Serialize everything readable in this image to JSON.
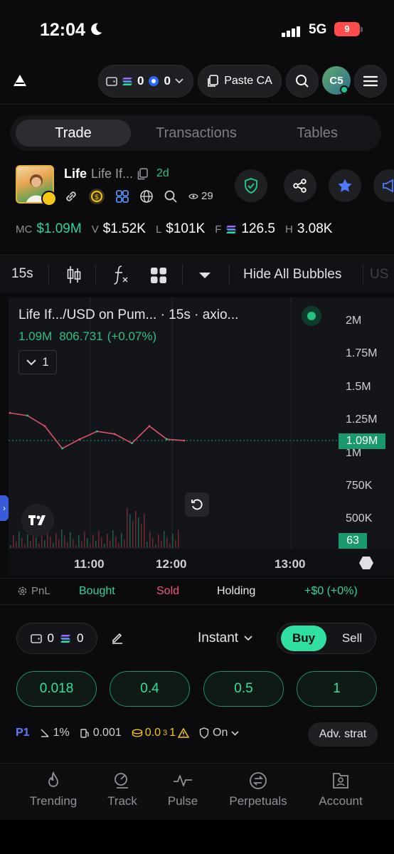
{
  "status": {
    "time": "12:04",
    "network": "5G",
    "battery": "9"
  },
  "topnav": {
    "sol_balance": "0",
    "coin_balance": "0",
    "paste_label": "Paste CA",
    "avatar_initials": "C5"
  },
  "tabs": [
    "Trade",
    "Transactions",
    "Tables"
  ],
  "token": {
    "name": "Life",
    "subtitle": "Life If...",
    "age": "2d",
    "watchers": "29"
  },
  "stats": {
    "mc_label": "MC",
    "mc_value": "$1.09M",
    "v_label": "V",
    "v_value": "$1.52K",
    "l_label": "L",
    "l_value": "$101K",
    "f_label": "F",
    "f_value": "126.5",
    "h_label": "H",
    "h_value": "3.08K"
  },
  "toolbar": {
    "interval": "15s",
    "hide_bubbles": "Hide All Bubbles",
    "currency": "US"
  },
  "chart": {
    "title": "Life If.../USD on Pum...   · 15s · axio...",
    "ohlc_value": "1.09M",
    "ohlc_price": "806.731",
    "ohlc_change": "(+0.07%)",
    "collapse_count": "1",
    "y_labels": [
      "2M",
      "1.75M",
      "1.5M",
      "1.25M",
      "1M",
      "750K",
      "500K"
    ],
    "price_tag": "1.09M",
    "volume_tag": "63",
    "x_labels": [
      "11:00",
      "12:00",
      "13:00"
    ]
  },
  "pnl": {
    "label": "PnL",
    "bought": "Bought",
    "sold": "Sold",
    "holding": "Holding",
    "total": "+$0 (+0%)"
  },
  "trade": {
    "wallet_balance": "0",
    "sol_amount": "0",
    "mode": "Instant",
    "buy": "Buy",
    "sell": "Sell",
    "amounts": [
      "0.018",
      "0.4",
      "0.5",
      "1"
    ],
    "preset": "P1",
    "slippage": "1%",
    "priority": "0.001",
    "bribe_main": "0.0",
    "bribe_sub": "3",
    "bribe_tail": "1",
    "protection": "On",
    "adv_label": "Adv. strat"
  },
  "bottom_nav": [
    {
      "label": "Trending",
      "icon": "flame-icon"
    },
    {
      "label": "Track",
      "icon": "track-icon"
    },
    {
      "label": "Pulse",
      "icon": "pulse-icon"
    },
    {
      "label": "Perpetuals",
      "icon": "perpetuals-icon"
    },
    {
      "label": "Account",
      "icon": "account-icon"
    }
  ],
  "chart_data": {
    "type": "line",
    "x": [
      "10:30",
      "10:40",
      "10:50",
      "11:00",
      "11:10",
      "11:20",
      "11:30",
      "11:40",
      "11:50",
      "12:00",
      "12:04"
    ],
    "series": [
      {
        "values": [
          1.3,
          1.28,
          1.2,
          1.03,
          1.1,
          1.16,
          1.14,
          1.07,
          1.2,
          1.1,
          1.09
        ]
      }
    ],
    "ylim": [
      0.4,
      2.1
    ],
    "unit": "M",
    "y_ticks": [
      "2M",
      "1.75M",
      "1.5M",
      "1.25M",
      "1M",
      "750K",
      "500K"
    ],
    "x_ticks": [
      "11:00",
      "12:00",
      "13:00"
    ],
    "last_value": "1.09M",
    "volume_last": "63",
    "grid": true
  }
}
